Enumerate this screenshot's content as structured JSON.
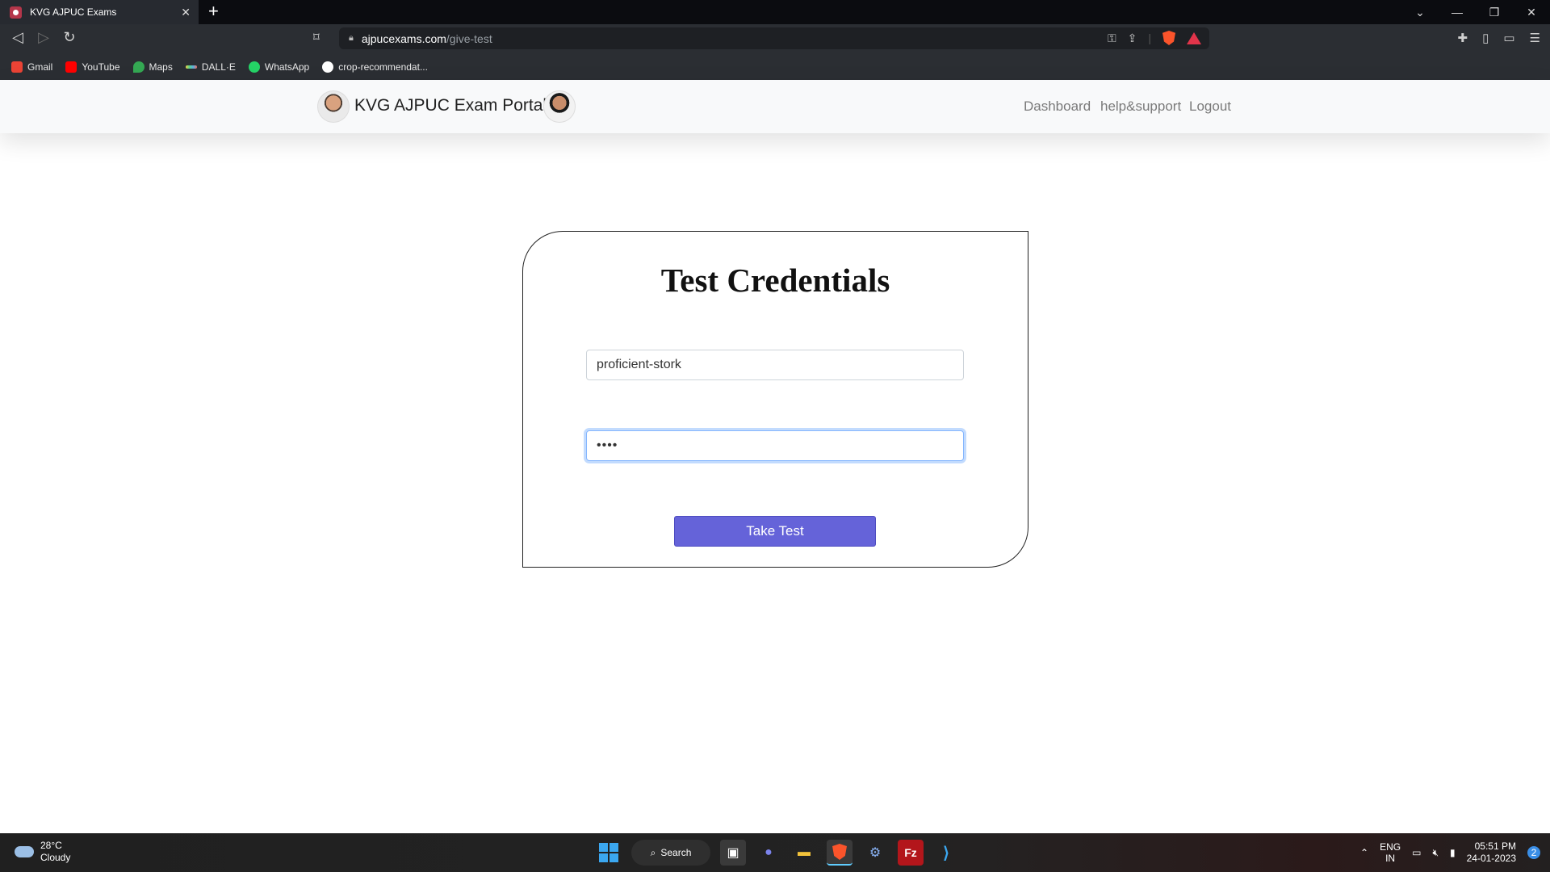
{
  "browser": {
    "tab_title": "KVG AJPUC Exams",
    "tab_close": "✕",
    "new_tab": "+",
    "url_host": "ajpucexams.com",
    "url_path": "/give-test",
    "window_controls": [
      "⌄",
      "—",
      "❐",
      "✕"
    ]
  },
  "bookmarks": [
    {
      "label": "Gmail",
      "icon": "gmail-icon",
      "color": "#ea4335"
    },
    {
      "label": "YouTube",
      "icon": "youtube-icon",
      "color": "#ff0000"
    },
    {
      "label": "Maps",
      "icon": "maps-icon",
      "color": "#34a853"
    },
    {
      "label": "DALL·E",
      "icon": "dalle-icon",
      "color": "#c9a227"
    },
    {
      "label": "WhatsApp",
      "icon": "whatsapp-icon",
      "color": "#25d366"
    },
    {
      "label": "crop-recommendat...",
      "icon": "github-icon",
      "color": "#ffffff"
    }
  ],
  "site": {
    "brand": "KVG AJPUC Exam Portal",
    "nav": {
      "dashboard": "Dashboard",
      "help": "help&support",
      "logout": "Logout"
    }
  },
  "form": {
    "title": "Test Credentials",
    "username_value": "proficient-stork",
    "password_value": "••••",
    "submit_label": "Take Test"
  },
  "taskbar": {
    "weather_temp": "28°C",
    "weather_desc": "Cloudy",
    "search_label": "Search",
    "lang_top": "ENG",
    "lang_bottom": "IN",
    "time": "05:51 PM",
    "date": "24-01-2023",
    "notifications": "2"
  },
  "colors": {
    "accent_button": "#6563d9",
    "browser_bg": "#2b2e33",
    "header_bg": "#f8f9fa"
  }
}
